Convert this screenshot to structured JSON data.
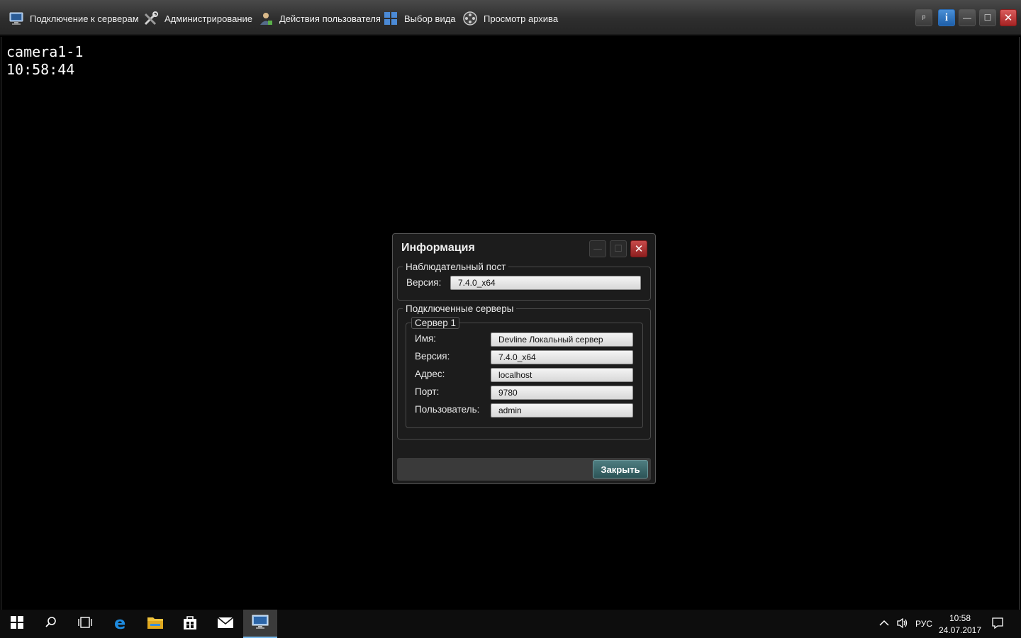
{
  "menubar": {
    "items": [
      {
        "label": "Подключение к серверам",
        "icon": "monitor-connect-icon"
      },
      {
        "label": "Администрирование",
        "icon": "tools-icon"
      },
      {
        "label": "Действия пользователя",
        "icon": "user-icon"
      },
      {
        "label": "Выбор вида",
        "icon": "grid-layout-icon"
      },
      {
        "label": "Просмотр архива",
        "icon": "film-reel-icon"
      }
    ],
    "pin_label": "ᵖ",
    "info_label": "i",
    "window_controls": {
      "minimize": "—",
      "maximize": "☐",
      "close": "✕"
    }
  },
  "video": {
    "camera_name": "camera1-1",
    "time": "10:58:44"
  },
  "dialog": {
    "title": "Информация",
    "controls": {
      "minimize": "—",
      "maximize": "☐",
      "close": "✕"
    },
    "post_section": {
      "legend": "Наблюдательный пост",
      "version_label": "Версия:",
      "version_value": "7.4.0_x64"
    },
    "servers_section": {
      "legend": "Подключенные серверы",
      "server": {
        "legend": "Сервер 1",
        "fields": [
          {
            "label": "Имя:",
            "value": "Devline Локальный сервер"
          },
          {
            "label": "Версия:",
            "value": "7.4.0_x64"
          },
          {
            "label": "Адрес:",
            "value": "localhost"
          },
          {
            "label": "Порт:",
            "value": "9780"
          },
          {
            "label": "Пользователь:",
            "value": "admin"
          }
        ]
      }
    },
    "close_button": "Закрыть"
  },
  "taskbar": {
    "language": "РУС",
    "time": "10:58",
    "date": "24.07.2017"
  },
  "colors": {
    "menubar": "#2e2e2e",
    "dialog_bg": "#1c1c1c",
    "close_button": "#3c6a6d",
    "accent_blue": "#1e5fa8",
    "close_red": "#a52323"
  }
}
